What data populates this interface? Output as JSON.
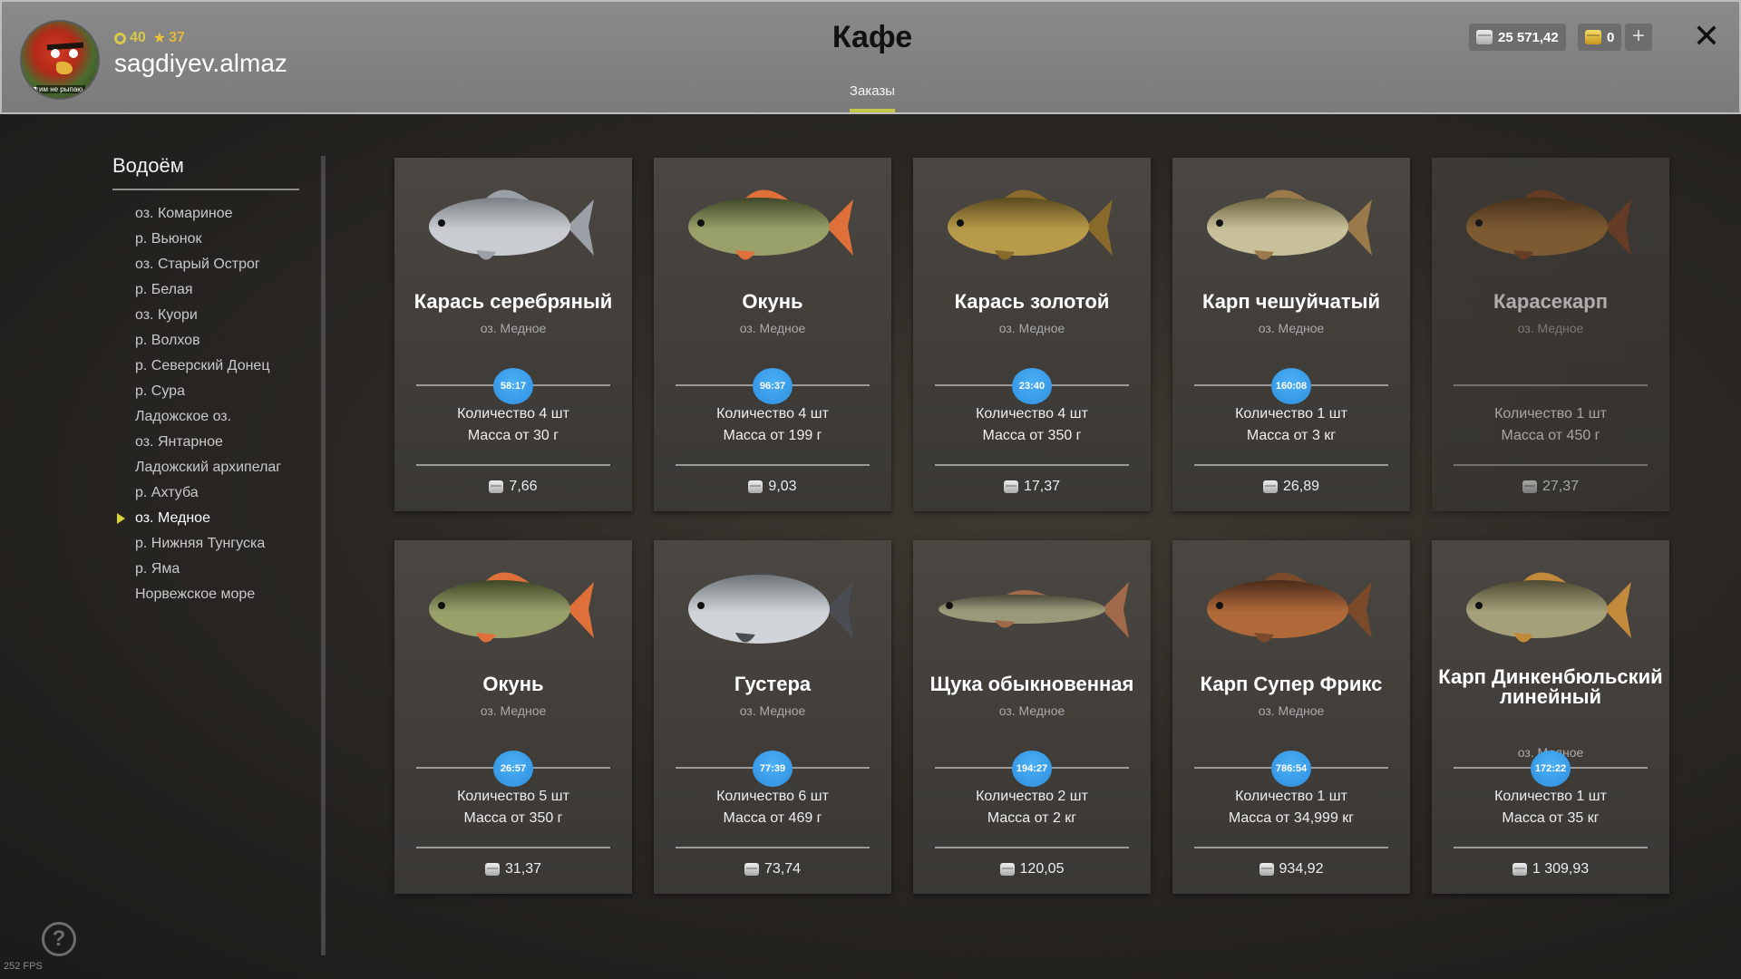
{
  "header": {
    "title": "Кафе",
    "tab": "Заказы",
    "player": {
      "level": "40",
      "rank": "37",
      "username": "sagdiyev.almaz",
      "avatar_tag": "им не рыпаю"
    },
    "silver": "25 571,42",
    "gold": "0",
    "plus": "+",
    "close": "✕"
  },
  "sidebar": {
    "title": "Водоём",
    "lakes": [
      "оз. Комариное",
      "р. Вьюнок",
      "оз. Старый Острог",
      "р. Белая",
      "оз. Куори",
      "р. Волхов",
      "р. Северский Донец",
      "р. Сура",
      "Ладожское оз.",
      "оз. Янтарное",
      "Ладожский архипелаг",
      "р. Ахтуба",
      "оз. Медное",
      "р. Нижняя Тунгуска",
      "р. Яма",
      "Норвежское море"
    ],
    "active_lake": "оз. Медное"
  },
  "orders": [
    {
      "name": "Карась серебряный",
      "lake": "оз. Медное",
      "timer": "58:17",
      "qty": "Количество 4 шт",
      "mass": "Масса от 30 г",
      "price": "7,66",
      "fish_icon": "crucian-silver"
    },
    {
      "name": "Окунь",
      "lake": "оз. Медное",
      "timer": "96:37",
      "qty": "Количество 4 шт",
      "mass": "Масса от 199 г",
      "price": "9,03",
      "fish_icon": "perch"
    },
    {
      "name": "Карась золотой",
      "lake": "оз. Медное",
      "timer": "23:40",
      "qty": "Количество 4 шт",
      "mass": "Масса от 350 г",
      "price": "17,37",
      "fish_icon": "crucian-gold"
    },
    {
      "name": "Карп чешуйчатый",
      "lake": "оз. Медное",
      "timer": "160:08",
      "qty": "Количество 1 шт",
      "mass": "Масса от 3 кг",
      "price": "26,89",
      "fish_icon": "carp-scaled"
    },
    {
      "name": "Карасекарп",
      "lake": "оз. Медное",
      "timer": "",
      "qty": "Количество 1 шт",
      "mass": "Масса от 450 г",
      "price": "27,37",
      "fish_icon": "crucian-carp",
      "disabled": true
    },
    {
      "name": "Окунь",
      "lake": "оз. Медное",
      "timer": "26:57",
      "qty": "Количество 5 шт",
      "mass": "Масса от 350 г",
      "price": "31,37",
      "fish_icon": "perch"
    },
    {
      "name": "Густера",
      "lake": "оз. Медное",
      "timer": "77:39",
      "qty": "Количество 6 шт",
      "mass": "Масса от 469 г",
      "price": "73,74",
      "fish_icon": "bream"
    },
    {
      "name": "Щука обыкновенная",
      "lake": "оз. Медное",
      "timer": "194:27",
      "qty": "Количество 2 шт",
      "mass": "Масса от 2 кг",
      "price": "120,05",
      "fish_icon": "pike"
    },
    {
      "name": "Карп Супер Фрикс",
      "lake": "оз. Медное",
      "timer": "786:54",
      "qty": "Количество 1 шт",
      "mass": "Масса от 34,999 кг",
      "price": "934,92",
      "fish_icon": "carp-frix"
    },
    {
      "name": "Карп Динкенбюльский линейный",
      "lake": "оз. Медное",
      "timer": "172:22",
      "qty": "Количество 1 шт",
      "mass": "Масса от 35 кг",
      "price": "1 309,93",
      "fish_icon": "carp-linear"
    }
  ],
  "footer": {
    "help": "?",
    "fps": "252 FPS"
  },
  "colors": {
    "accent_yellow": "#d9d13a",
    "timer_blue": "#2f8fe0",
    "header_gray": "#7f7f7f"
  }
}
